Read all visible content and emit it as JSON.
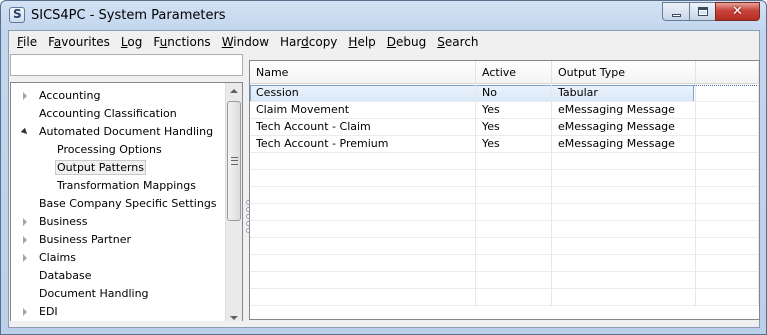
{
  "window": {
    "title": "SICS4PC - System Parameters",
    "buttons": {
      "minimize": "minimize",
      "maximize": "maximize",
      "close": "✕"
    }
  },
  "menu": [
    {
      "label": "File",
      "accel_index": 0
    },
    {
      "label": "Favourites",
      "accel_index": 1
    },
    {
      "label": "Log",
      "accel_index": 0
    },
    {
      "label": "Functions",
      "accel_index": 1
    },
    {
      "label": "Window",
      "accel_index": 0
    },
    {
      "label": "Hardcopy",
      "accel_index": 3
    },
    {
      "label": "Help",
      "accel_index": 0
    },
    {
      "label": "Debug",
      "accel_index": 0
    },
    {
      "label": "Search",
      "accel_index": 0
    }
  ],
  "search": {
    "value": "",
    "placeholder": ""
  },
  "tree": {
    "items": [
      {
        "label": "Accounting",
        "level": 0,
        "expander": "collapsed"
      },
      {
        "label": "Accounting Classification",
        "level": 0,
        "expander": "none"
      },
      {
        "label": "Automated Document Handling",
        "level": 0,
        "expander": "expanded"
      },
      {
        "label": "Processing Options",
        "level": 1,
        "expander": "none"
      },
      {
        "label": "Output Patterns",
        "level": 1,
        "expander": "none",
        "selected": true
      },
      {
        "label": "Transformation Mappings",
        "level": 1,
        "expander": "none"
      },
      {
        "label": "Base Company Specific Settings",
        "level": 0,
        "expander": "none"
      },
      {
        "label": "Business",
        "level": 0,
        "expander": "collapsed"
      },
      {
        "label": "Business Partner",
        "level": 0,
        "expander": "collapsed"
      },
      {
        "label": "Claims",
        "level": 0,
        "expander": "collapsed"
      },
      {
        "label": "Database",
        "level": 0,
        "expander": "none"
      },
      {
        "label": "Document Handling",
        "level": 0,
        "expander": "none"
      },
      {
        "label": "EDI",
        "level": 0,
        "expander": "collapsed"
      }
    ]
  },
  "grid": {
    "columns": [
      "Name",
      "Active",
      "Output Type",
      ""
    ],
    "rows": [
      {
        "name": "Cession",
        "active": "No",
        "output_type": "Tabular",
        "selected": true
      },
      {
        "name": "Claim Movement",
        "active": "Yes",
        "output_type": "eMessaging Message"
      },
      {
        "name": "Tech Account - Claim",
        "active": "Yes",
        "output_type": "eMessaging Message"
      },
      {
        "name": "Tech Account - Premium",
        "active": "Yes",
        "output_type": "eMessaging Message"
      }
    ],
    "empty_rows": 9
  },
  "colors": {
    "selection_border": "#7da2ce",
    "selection_fill": "#dbe8f8",
    "close_button": "#c7433a",
    "frame": "#bcd0ea"
  }
}
